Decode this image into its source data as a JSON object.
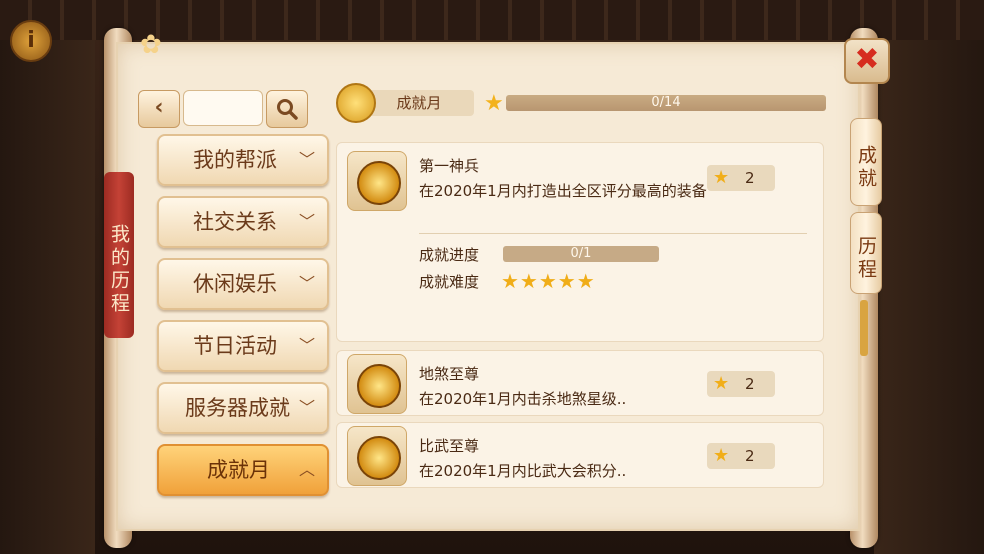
{
  "sidebar": {
    "banner_label": "我的历程",
    "back_label": "‹",
    "search_placeholder": "",
    "categories": [
      {
        "label": "我的帮派",
        "chevron": "﹀"
      },
      {
        "label": "社交关系",
        "chevron": "﹀"
      },
      {
        "label": "休闲娱乐",
        "chevron": "﹀"
      },
      {
        "label": "节日活动",
        "chevron": "﹀"
      },
      {
        "label": "服务器成就",
        "chevron": "﹀"
      },
      {
        "label": "成就月",
        "chevron": "︿",
        "active": true
      }
    ]
  },
  "header": {
    "title": "成就月",
    "progress_text": "0/14",
    "progress": 0
  },
  "achievements": [
    {
      "title": "第一神兵",
      "desc": "在2020年1月内打造出全区评分最高的装备",
      "reward": "2",
      "progress_label": "成就进度",
      "progress_text": "0/1",
      "progress": 0,
      "difficulty_label": "成就难度",
      "difficulty_stars": "★★★★★",
      "difficulty": 5
    },
    {
      "title": "地煞至尊",
      "desc": "在2020年1月内击杀地煞星级..",
      "reward": "2"
    },
    {
      "title": "比武至尊",
      "desc": "在2020年1月内比武大会积分..",
      "reward": "2"
    }
  ],
  "right_tabs": {
    "tab1": "成就",
    "tab2": "历程",
    "close": "✖"
  },
  "icons": {
    "info": "i",
    "star": "★"
  },
  "colors": {
    "active_tab": "#f0a13a",
    "banner_red": "#c44236",
    "star_gold": "#f1ae19"
  }
}
